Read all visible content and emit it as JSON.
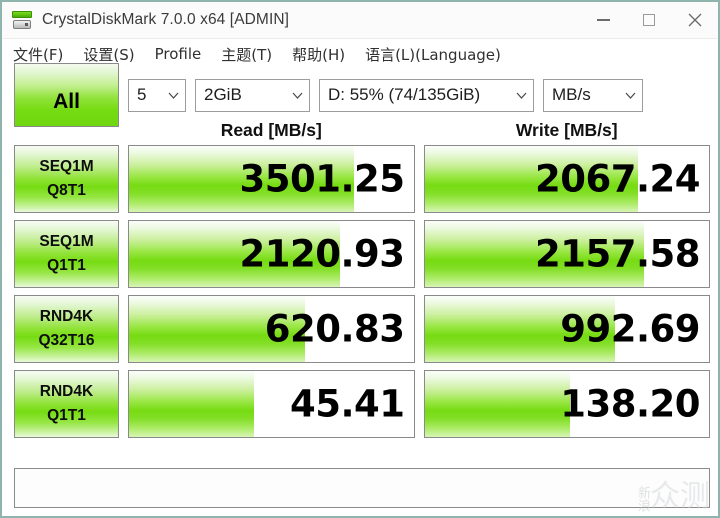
{
  "window": {
    "title": "CrystalDiskMark 7.0.0 x64 [ADMIN]",
    "icon": "crystaldiskmark-icon",
    "border_color": "#8fb3ad",
    "controls": {
      "minimize": "minimize-icon",
      "maximize": "maximize-icon",
      "close": "close-icon"
    }
  },
  "menubar": {
    "items": [
      {
        "label": "文件(F)"
      },
      {
        "label": "设置(S)"
      },
      {
        "label": "Profile"
      },
      {
        "label": "主题(T)"
      },
      {
        "label": "帮助(H)"
      },
      {
        "label": "语言(L)(Language)"
      }
    ]
  },
  "toolbar": {
    "all_button": "All",
    "accent_color": "#76dc12",
    "combos": [
      {
        "name": "test-count",
        "value": "5"
      },
      {
        "name": "test-size",
        "value": "2GiB"
      },
      {
        "name": "target-drive",
        "value": "D: 55% (74/135GiB)"
      },
      {
        "name": "unit",
        "value": "MB/s"
      }
    ]
  },
  "columns": {
    "read": "Read [MB/s]",
    "write": "Write [MB/s]"
  },
  "chart_data": {
    "type": "bar",
    "title": "CrystalDiskMark 7.0.0 benchmark results",
    "xlabel": "",
    "ylabel": "MB/s",
    "categories": [
      "SEQ1M Q8T1",
      "SEQ1M Q1T1",
      "RND4K Q32T16",
      "RND4K Q1T1"
    ],
    "series": [
      {
        "name": "Read [MB/s]",
        "values": [
          3501.25,
          2120.93,
          620.83,
          45.41
        ]
      },
      {
        "name": "Write [MB/s]",
        "values": [
          2067.24,
          2157.58,
          992.69,
          138.2
        ]
      }
    ],
    "bar_fill_percent": {
      "read": [
        79,
        74,
        62,
        44
      ],
      "write": [
        75,
        77,
        67,
        51
      ]
    },
    "legend_position": "top",
    "grid": false
  },
  "rows": [
    {
      "label_line1": "SEQ1M",
      "label_line2": "Q8T1",
      "read": {
        "value": "3501.25",
        "fill": 79
      },
      "write": {
        "value": "2067.24",
        "fill": 75
      }
    },
    {
      "label_line1": "SEQ1M",
      "label_line2": "Q1T1",
      "read": {
        "value": "2120.93",
        "fill": 74
      },
      "write": {
        "value": "2157.58",
        "fill": 77
      }
    },
    {
      "label_line1": "RND4K",
      "label_line2": "Q32T16",
      "read": {
        "value": "620.83",
        "fill": 62
      },
      "write": {
        "value": "992.69",
        "fill": 67
      }
    },
    {
      "label_line1": "RND4K",
      "label_line2": "Q1T1",
      "read": {
        "value": "45.41",
        "fill": 44
      },
      "write": {
        "value": "138.20",
        "fill": 51
      }
    }
  ],
  "statusbar": {
    "text": ""
  },
  "watermark": {
    "small": "新浪",
    "big": "众测"
  }
}
